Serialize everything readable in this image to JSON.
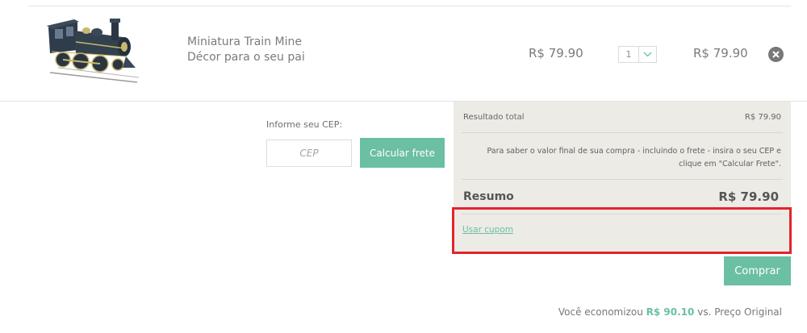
{
  "cart": {
    "item": {
      "name_line1": "Miniatura Train Mine",
      "name_line2": "Décor para o seu pai",
      "unit_price": "R$ 79.90",
      "quantity": "1",
      "total_price": "R$ 79.90",
      "image_icon": "locomotive-image",
      "remove_icon": "close-icon"
    }
  },
  "shipping": {
    "label": "Informe seu CEP:",
    "placeholder": "CEP",
    "button_label": "Calcular frete"
  },
  "summary": {
    "result_label": "Resultado total",
    "result_value": "R$ 79.90",
    "info_line1": "Para saber o valor final de sua compra - incluindo o frete - insira o seu CEP e",
    "info_line2": "clique em \"Calcular Frete\".",
    "resumo_label": "Resumo",
    "resumo_value": "R$ 79.90",
    "coupon_link": "Usar cupom"
  },
  "actions": {
    "buy_label": "Comprar"
  },
  "savings": {
    "prefix": "Você economizou",
    "amount": "R$ 90.10",
    "suffix": "vs. Preço Original"
  },
  "colors": {
    "accent": "#6bbfa3",
    "panel": "#ecebe5",
    "highlight": "#e3242b"
  }
}
